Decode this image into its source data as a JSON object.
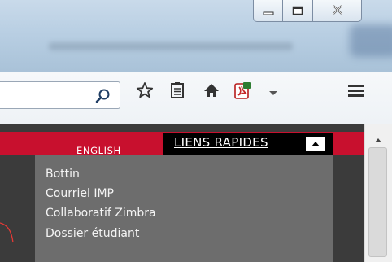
{
  "window": {
    "buttons": [
      {
        "icon": "minimize-icon"
      },
      {
        "icon": "maximize-icon"
      },
      {
        "icon": "close-icon"
      }
    ]
  },
  "toolbar": {
    "url_value": "",
    "icons": [
      "search-icon",
      "bookmark-star-icon",
      "reading-list-icon",
      "home-icon",
      "pdf-addon-icon",
      "dropdown-arrow-icon",
      "hamburger-menu-icon"
    ]
  },
  "header": {
    "language_link": "ENGLISH",
    "quick_links_label": "LIENS RAPIDES"
  },
  "quick_links_menu": {
    "items": [
      {
        "label": "Bottin"
      },
      {
        "label": "Courriel IMP"
      },
      {
        "label": "Collaboratif Zimbra"
      },
      {
        "label": "Dossier étudiant"
      }
    ]
  },
  "colors": {
    "brand_red": "#c8102e",
    "menu_bg": "#6d6d6d",
    "page_dark": "#3b3b3b",
    "quick_links_bg": "#000000",
    "titlebar": "#b9cfe3"
  }
}
